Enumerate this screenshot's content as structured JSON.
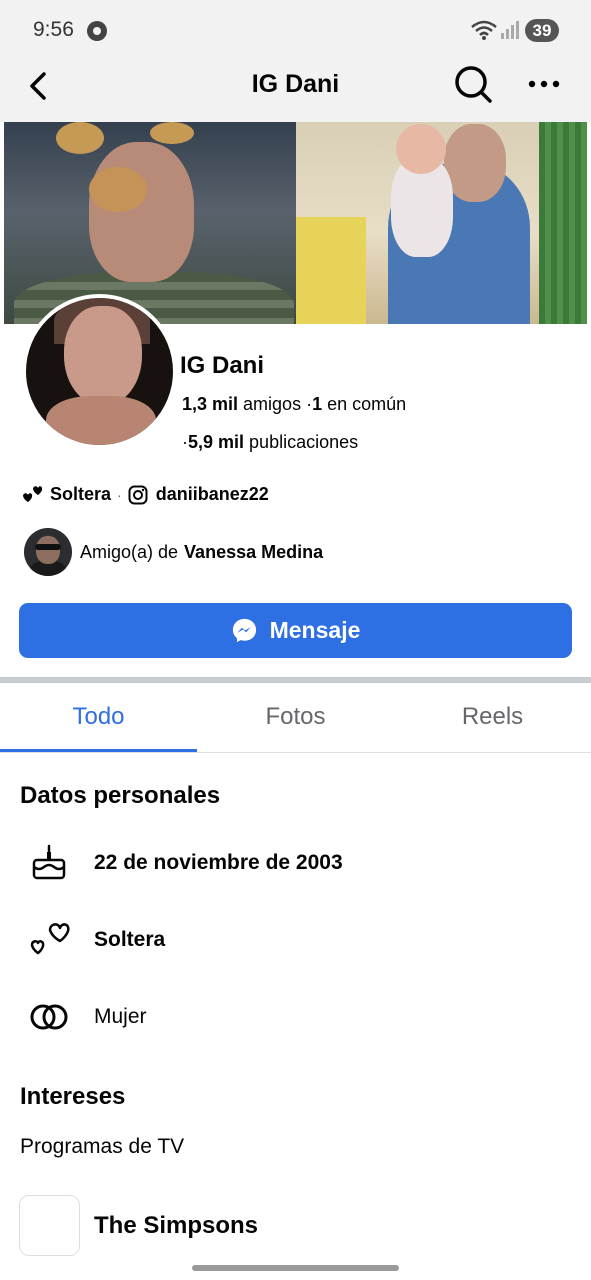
{
  "status_bar": {
    "time": "9:56",
    "battery": "39"
  },
  "header": {
    "title": "IG Dani",
    "back_icon": "back-arrow-icon",
    "search_icon": "search-icon",
    "more_icon": "more-options-icon"
  },
  "profile": {
    "name": "IG Dani",
    "friends_count": "1,3 mil",
    "friends_label": "amigos",
    "mutual_count": "1",
    "mutual_label": "en común",
    "posts_count": "5,9 mil",
    "posts_label": "publicaciones",
    "relationship": "Soltera",
    "instagram": "daniibanez22",
    "friend_of_label": "Amigo(a) de",
    "friend_of_name": "Vanessa Medina"
  },
  "actions": {
    "message_label": "Mensaje"
  },
  "tabs": [
    {
      "label": "Todo",
      "active": true
    },
    {
      "label": "Fotos",
      "active": false
    },
    {
      "label": "Reels",
      "active": false
    }
  ],
  "personal_data": {
    "title": "Datos personales",
    "birthday": "22 de noviembre de 2003",
    "relationship": "Soltera",
    "gender": "Mujer"
  },
  "interests": {
    "title": "Intereses",
    "category": "Programas de TV",
    "items": [
      {
        "name": "The Simpsons"
      }
    ]
  },
  "colors": {
    "accent": "#2f6fe4",
    "statusbar_bg": "#f2f2f2"
  }
}
